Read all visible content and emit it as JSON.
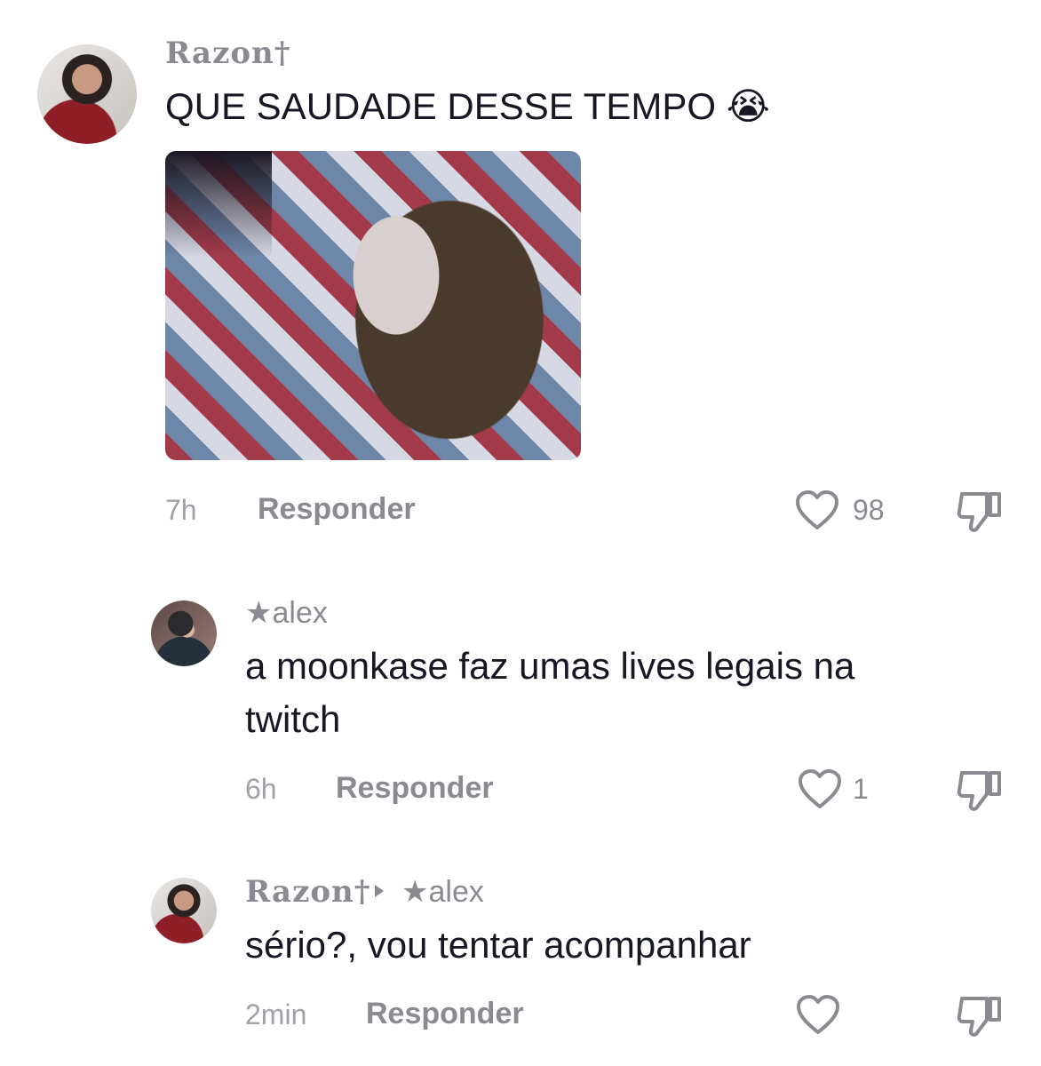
{
  "comments": [
    {
      "username": "Razon†",
      "text": "QUE SAUDADE DESSE TEMPO 😭",
      "time": "7h",
      "reply_label": "Responder",
      "likes": "98"
    },
    {
      "username": "★alex",
      "text": "a moonkase faz umas lives legais na twitch",
      "time": "6h",
      "reply_label": "Responder",
      "likes": "1"
    },
    {
      "username": "Razon†",
      "reply_to": "★alex",
      "text": "sério?, vou tentar acompanhar",
      "time": "2min",
      "reply_label": "Responder",
      "likes": ""
    }
  ],
  "colors": {
    "text_primary": "#161823",
    "text_secondary": "#8a8b91",
    "background": "#ffffff"
  },
  "icons": [
    "heart-outline-icon",
    "dislike-icon",
    "reply-arrow-icon"
  ]
}
